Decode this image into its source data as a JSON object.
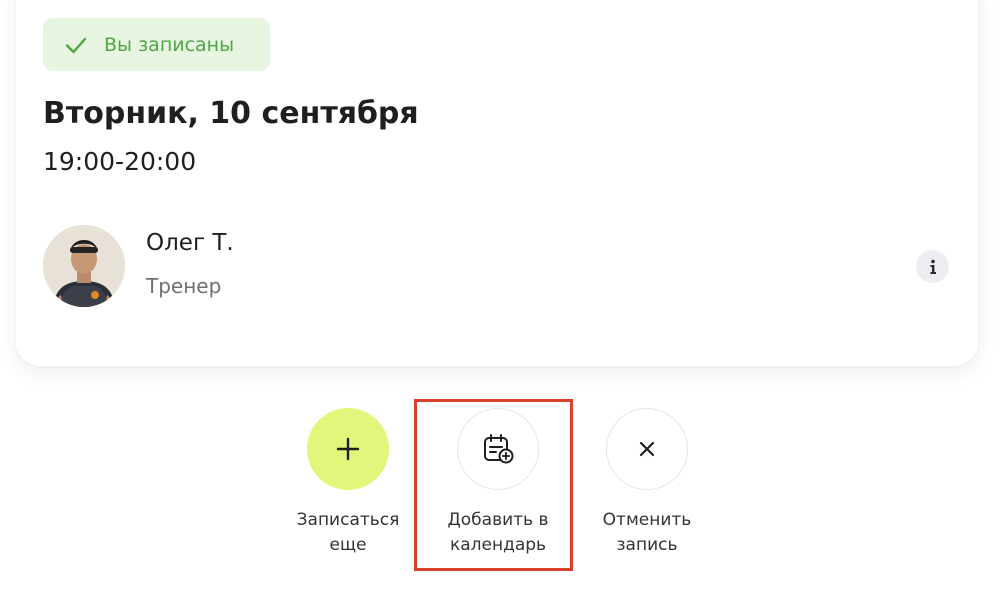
{
  "status": {
    "label": "Вы записаны",
    "icon": "check-icon",
    "color": "#4fa646",
    "background": "#e8f6e1"
  },
  "session": {
    "date": "Вторник, 10 сентября",
    "time": "19:00-20:00"
  },
  "trainer": {
    "name": "Олег Т.",
    "role": "Тренер",
    "info_icon": "info-icon"
  },
  "actions": [
    {
      "id": "sign-up-more",
      "label_line1": "Записаться",
      "label_line2": "еще",
      "icon": "plus-icon",
      "accent": "#e3f57a"
    },
    {
      "id": "add-to-calendar",
      "label_line1": "Добавить в",
      "label_line2": "календарь",
      "icon": "calendar-add-icon",
      "highlighted": true,
      "highlight_color": "#d9402b"
    },
    {
      "id": "cancel-booking",
      "label_line1": "Отменить",
      "label_line2": "запись",
      "icon": "close-icon"
    }
  ]
}
